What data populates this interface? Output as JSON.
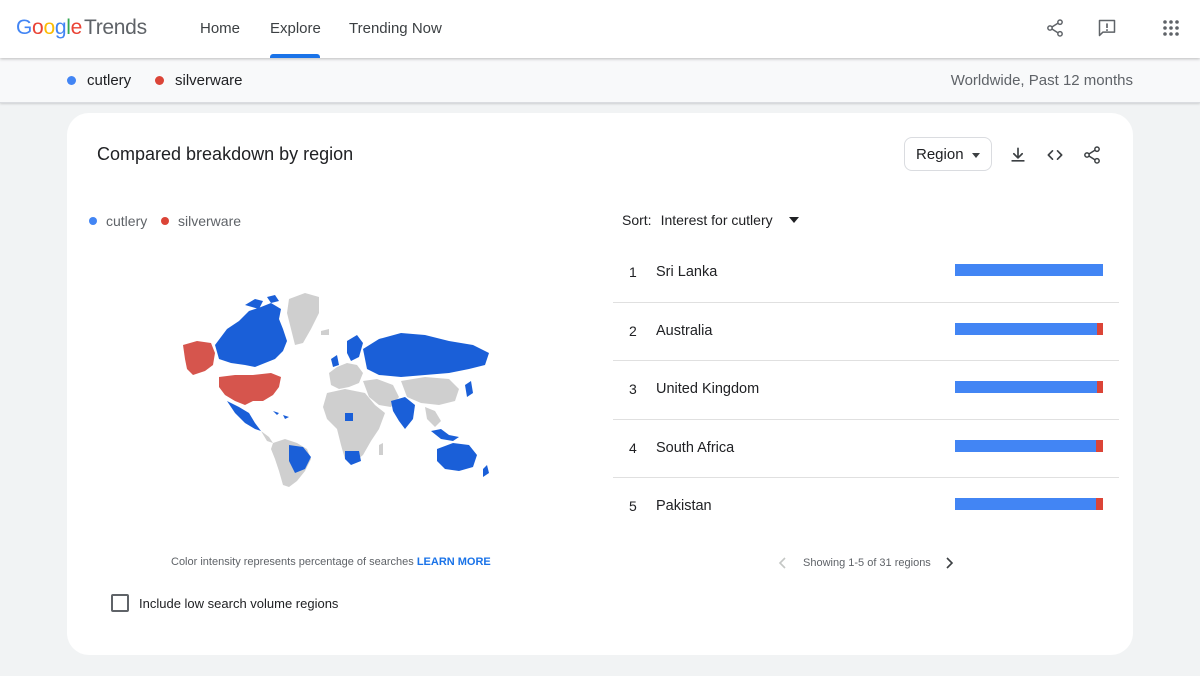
{
  "header": {
    "logo_google": "Google",
    "logo_trends": "Trends",
    "nav": [
      {
        "label": "Home",
        "active": false
      },
      {
        "label": "Explore",
        "active": true
      },
      {
        "label": "Trending Now",
        "active": false
      }
    ],
    "icons": [
      "share-icon",
      "feedback-icon",
      "apps-icon"
    ]
  },
  "compare": {
    "terms": [
      {
        "label": "cutlery",
        "color": "#4285f4"
      },
      {
        "label": "silverware",
        "color": "#db4437"
      }
    ],
    "scope": "Worldwide, Past 12 months"
  },
  "card": {
    "title": "Compared breakdown by region",
    "resolution_select": "Region",
    "icons": [
      "download-icon",
      "embed-icon",
      "share-icon"
    ],
    "legend": [
      {
        "label": "cutlery",
        "color": "#4285f4"
      },
      {
        "label": "silverware",
        "color": "#db4437"
      }
    ],
    "map_colors": {
      "cutlery": "#1a5fd8",
      "silverware": "#d6554d",
      "no_data": "#cfcfcf"
    },
    "caption_text": "Color intensity represents percentage of searches ",
    "caption_link": "LEARN MORE",
    "checkbox_label": "Include low search volume regions",
    "checkbox_checked": false,
    "sort_label": "Sort:",
    "sort_value": "Interest for cutlery",
    "rows": [
      {
        "rank": "1",
        "name": "Sri Lanka",
        "cutlery_share": 1.0,
        "silverware_share": 0.0
      },
      {
        "rank": "2",
        "name": "Australia",
        "cutlery_share": 0.96,
        "silverware_share": 0.04
      },
      {
        "rank": "3",
        "name": "United Kingdom",
        "cutlery_share": 0.96,
        "silverware_share": 0.04
      },
      {
        "rank": "4",
        "name": "South Africa",
        "cutlery_share": 0.95,
        "silverware_share": 0.05
      },
      {
        "rank": "5",
        "name": "Pakistan",
        "cutlery_share": 0.95,
        "silverware_share": 0.05
      }
    ],
    "pagination": "Showing 1-5 of 31 regions"
  }
}
